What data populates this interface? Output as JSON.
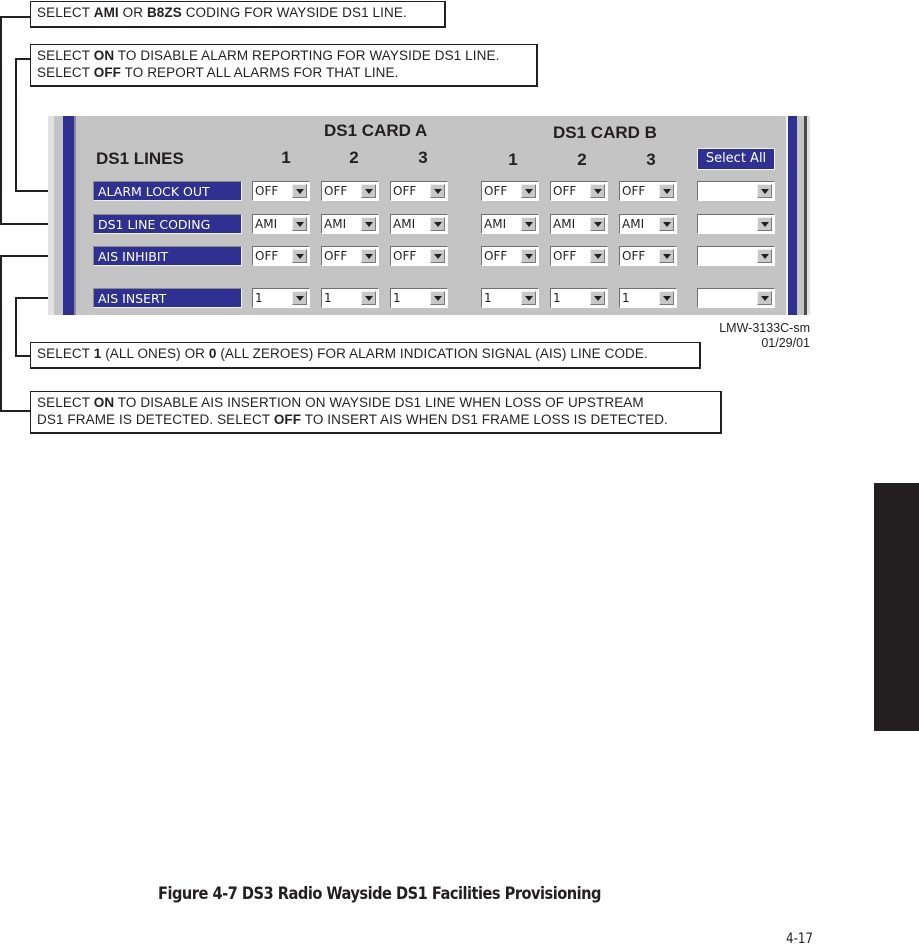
{
  "callouts": {
    "coding": {
      "p1": "SELECT ",
      "b1": "AMI",
      "p2": " OR ",
      "b2": "B8ZS",
      "p3": " CODING FOR WAYSIDE DS1 LINE."
    },
    "alarm_lock": {
      "line1": {
        "p1": "SELECT ",
        "b1": "ON",
        "p2": " TO DISABLE ALARM REPORTING FOR WAYSIDE DS1 LINE."
      },
      "line2": {
        "p1": "SELECT ",
        "b1": "OFF",
        "p2": " TO REPORT ALL ALARMS FOR THAT LINE."
      }
    },
    "ais_insert": {
      "p1": "SELECT ",
      "b1": "1",
      "p2": " (ALL ONES) OR ",
      "b2": "0",
      "p3": " (ALL ZEROES) FOR ALARM INDICATION SIGNAL (AIS) LINE CODE."
    },
    "ais_inhibit": {
      "line1": {
        "p1": "SELECT ",
        "b1": "ON",
        "p2": " TO DISABLE AIS INSERTION ON WAYSIDE DS1 LINE WHEN LOSS OF UPSTREAM"
      },
      "line2": {
        "p1": "DS1 FRAME IS DETECTED. SELECT ",
        "b1": "OFF",
        "p2": " TO INSERT AIS WHEN DS1 FRAME LOSS IS DETECTED."
      }
    }
  },
  "panel": {
    "lines_header": "DS1 LINES",
    "card_a": {
      "title": "DS1 CARD A",
      "columns": [
        "1",
        "2",
        "3"
      ]
    },
    "card_b": {
      "title": "DS1 CARD B",
      "columns": [
        "1",
        "2",
        "3"
      ]
    },
    "select_all_label": "Select All",
    "rows": [
      {
        "label": "ALARM LOCK OUT",
        "values": [
          "OFF",
          "OFF",
          "OFF",
          "OFF",
          "OFF",
          "OFF"
        ],
        "select_all": ""
      },
      {
        "label": "DS1 LINE CODING",
        "values": [
          "AMI",
          "AMI",
          "AMI",
          "AMI",
          "AMI",
          "AMI"
        ],
        "select_all": ""
      },
      {
        "label": "AIS INHIBIT",
        "values": [
          "OFF",
          "OFF",
          "OFF",
          "OFF",
          "OFF",
          "OFF"
        ],
        "select_all": ""
      },
      {
        "label": "AIS INSERT",
        "values": [
          "1",
          "1",
          "1",
          "1",
          "1",
          "1"
        ],
        "select_all": ""
      }
    ]
  },
  "figure_id": {
    "line1": "LMW-3133C-sm",
    "line2": "01/29/01"
  },
  "caption": "Figure 4-7  DS3 Radio Wayside DS1 Facilities Provisioning",
  "page_number": "4-17",
  "colors": {
    "panel_blue": "#2e3192",
    "panel_gray": "#c4c4c4",
    "ink": "#231f20"
  }
}
